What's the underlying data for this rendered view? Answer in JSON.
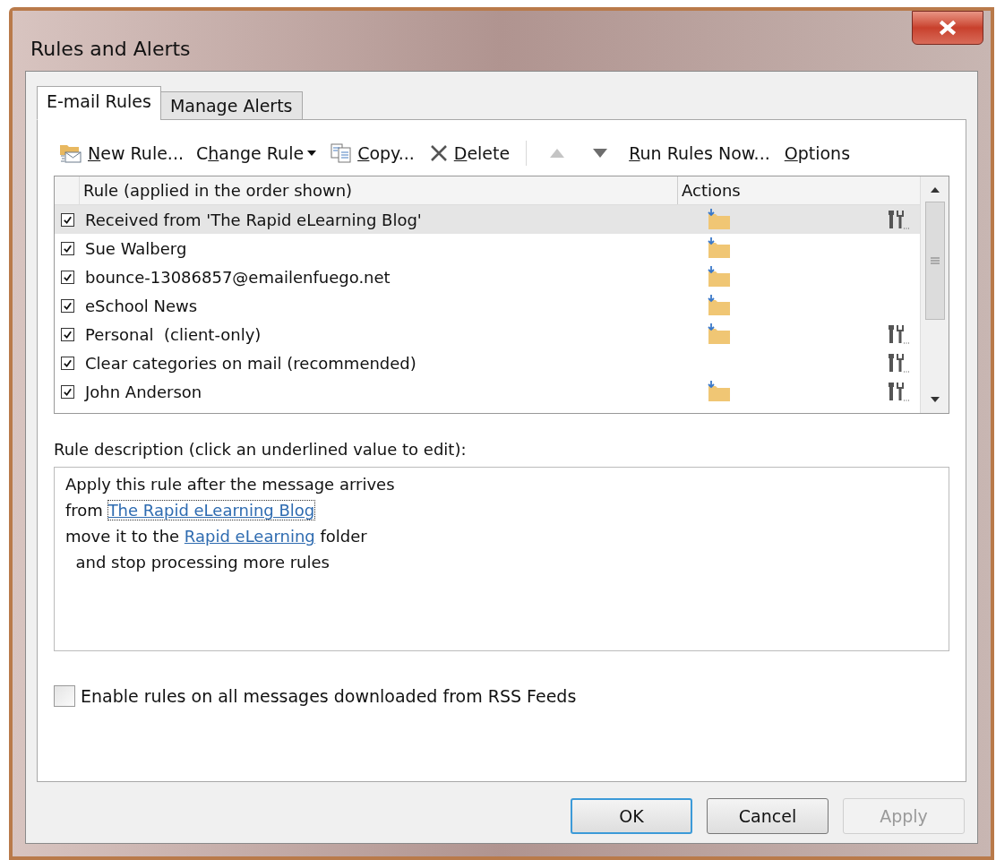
{
  "window": {
    "title": "Rules and Alerts"
  },
  "tabs": [
    {
      "label": "E-mail Rules",
      "selected": true
    },
    {
      "label": "Manage Alerts",
      "selected": false
    }
  ],
  "toolbar": [
    {
      "kind": "new",
      "label": [
        {
          "text": "N",
          "underlined": true
        },
        {
          "text": "ew Rule...",
          "underlined": false
        }
      ]
    },
    {
      "kind": "dropdown",
      "label": [
        {
          "text": "C",
          "underlined": false
        },
        {
          "text": "h",
          "underlined": true
        },
        {
          "text": "ange Rule",
          "underlined": false
        }
      ]
    },
    {
      "kind": "copy",
      "label": [
        {
          "text": "C",
          "underlined": true
        },
        {
          "text": "opy...",
          "underlined": false
        }
      ]
    },
    {
      "kind": "delete",
      "label": [
        {
          "text": "D",
          "underlined": true
        },
        {
          "text": "elete",
          "underlined": false
        }
      ]
    },
    {
      "kind": "separator"
    },
    {
      "kind": "up",
      "disabled": true
    },
    {
      "kind": "down",
      "disabled": false
    },
    {
      "kind": "text",
      "label": [
        {
          "text": "R",
          "underlined": true
        },
        {
          "text": "un Rules Now...",
          "underlined": false
        }
      ]
    },
    {
      "kind": "text",
      "label": [
        {
          "text": "O",
          "underlined": true
        },
        {
          "text": "ptions",
          "underlined": false
        }
      ]
    }
  ],
  "rules_table": {
    "columns": [
      "Rule (applied in the order shown)",
      "Actions"
    ],
    "rows": [
      {
        "name": "Received from 'The Rapid eLearning Blog'",
        "checked": true,
        "selected": true,
        "move_to_folder": true,
        "custom_action": true
      },
      {
        "name": "Sue Walberg",
        "checked": true,
        "selected": false,
        "move_to_folder": true,
        "custom_action": false
      },
      {
        "name": "bounce-13086857@emailenfuego.net",
        "checked": true,
        "selected": false,
        "move_to_folder": true,
        "custom_action": false
      },
      {
        "name": "eSchool News",
        "checked": true,
        "selected": false,
        "move_to_folder": true,
        "custom_action": false
      },
      {
        "name": "Personal  (client-only)",
        "checked": true,
        "selected": false,
        "move_to_folder": true,
        "custom_action": true
      },
      {
        "name": "Clear categories on mail (recommended)",
        "checked": true,
        "selected": false,
        "move_to_folder": false,
        "custom_action": true
      },
      {
        "name": "John Anderson",
        "checked": true,
        "selected": false,
        "move_to_folder": true,
        "custom_action": true
      }
    ]
  },
  "description": {
    "label": "Rule description (click an underlined value to edit):",
    "lines": [
      [
        {
          "text": "Apply this rule after the message arrives"
        }
      ],
      [
        {
          "text": "from "
        },
        {
          "text": "The Rapid eLearning Blog",
          "link": true,
          "focused": true
        }
      ],
      [
        {
          "text": "move it to the "
        },
        {
          "text": "Rapid eLearning",
          "link": true,
          "focused": false
        },
        {
          "text": " folder"
        }
      ],
      [
        {
          "text": "  and stop processing more rules"
        }
      ]
    ]
  },
  "rss_option": {
    "label": "Enable rules on all messages downloaded from RSS Feeds",
    "checked": false
  },
  "buttons": [
    {
      "label": "OK",
      "default": true,
      "disabled": false
    },
    {
      "label": "Cancel",
      "default": false,
      "disabled": false
    },
    {
      "label": "Apply",
      "default": false,
      "disabled": true
    }
  ]
}
